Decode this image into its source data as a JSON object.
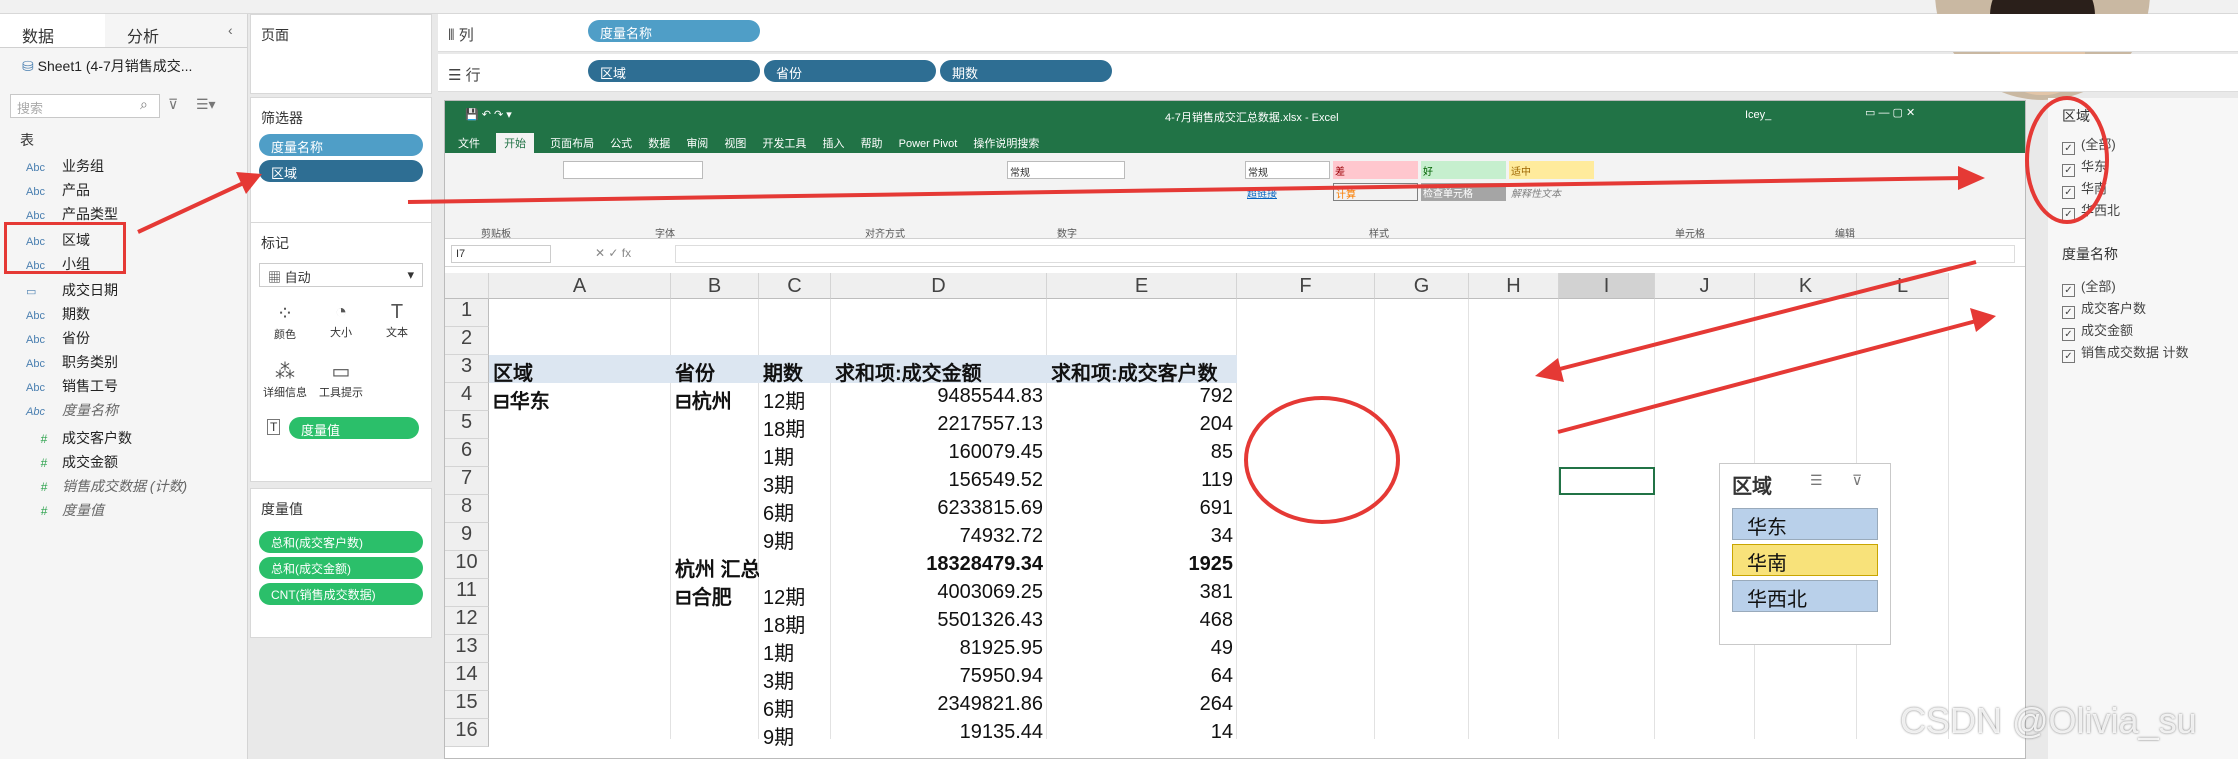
{
  "data_pane": {
    "tab_data": "数据",
    "tab_analysis": "分析",
    "datasource": "Sheet1 (4-7月销售成交...",
    "search_placeholder": "搜索",
    "table_header": "表",
    "dims": [
      "业务组",
      "产品",
      "产品类型",
      "区域",
      "小组",
      "成交日期",
      "期数",
      "省份",
      "职务类别",
      "销售工号"
    ],
    "measure_names": "度量名称",
    "measures": [
      "成交客户数",
      "成交金额",
      "销售成交数据 (计数)",
      "度量值"
    ]
  },
  "pages": {
    "label": "页面"
  },
  "filters": {
    "label": "筛选器",
    "pills": [
      "度量名称",
      "区域"
    ]
  },
  "marks": {
    "label": "标记",
    "type": "自动",
    "cells": [
      "颜色",
      "大小",
      "文本",
      "详细信息",
      "工具提示"
    ],
    "pill": "度量值"
  },
  "measure_values": {
    "label": "度量值",
    "pills": [
      "总和(成交客户数)",
      "总和(成交金额)",
      "CNT(销售成交数据)"
    ]
  },
  "columns": {
    "label": "列",
    "pills": [
      "度量名称"
    ]
  },
  "rows": {
    "label": "行",
    "pills": [
      "区域",
      "省份",
      "期数"
    ]
  },
  "excel": {
    "title": "4-7月销售成交汇总数据.xlsx - Excel",
    "user": "Icey_",
    "menu": [
      "文件",
      "开始",
      "页面布局",
      "公式",
      "数据",
      "审阅",
      "视图",
      "开发工具",
      "插入",
      "帮助",
      "Power Pivot",
      "操作说明搜索"
    ],
    "namebox": "I7",
    "ribbon_groups": [
      "剪贴板",
      "字体",
      "对齐方式",
      "数字",
      "样式",
      "单元格",
      "编辑"
    ],
    "style_labels": [
      "常规",
      "差",
      "好",
      "适中",
      "超链接",
      "计算",
      "检查单元格",
      "解释性文本"
    ],
    "columns": [
      "A",
      "B",
      "C",
      "D",
      "E",
      "F",
      "G",
      "H",
      "I",
      "J",
      "K",
      "L"
    ],
    "rows": [
      "1",
      "2",
      "3",
      "4",
      "5",
      "6",
      "7",
      "8",
      "9",
      "10",
      "11",
      "12",
      "13",
      "14",
      "15",
      "16"
    ],
    "headers": [
      "区域",
      "省份",
      "期数",
      "求和项:成交金额",
      "求和项:成交客户数"
    ],
    "region": "⊟华东",
    "province1": "⊟杭州",
    "province2": "⊟合肥",
    "subtotal_label": "杭州 汇总",
    "data": [
      [
        "12期",
        "9485544.83",
        "792"
      ],
      [
        "18期",
        "2217557.13",
        "204"
      ],
      [
        "1期",
        "160079.45",
        "85"
      ],
      [
        "3期",
        "156549.52",
        "119"
      ],
      [
        "6期",
        "6233815.69",
        "691"
      ],
      [
        "9期",
        "74932.72",
        "34"
      ],
      [
        "",
        "18328479.34",
        "1925"
      ],
      [
        "12期",
        "4003069.25",
        "381"
      ],
      [
        "18期",
        "5501326.43",
        "468"
      ],
      [
        "1期",
        "81925.95",
        "49"
      ],
      [
        "3期",
        "75950.94",
        "64"
      ],
      [
        "6期",
        "2349821.86",
        "264"
      ],
      [
        "9期",
        "19135.44",
        "14"
      ]
    ]
  },
  "slicer": {
    "title": "区域",
    "items": [
      "华东",
      "华南",
      "华西北"
    ]
  },
  "legend_region": {
    "title": "区域",
    "items": [
      "(全部)",
      "华东",
      "华南",
      "华西北"
    ]
  },
  "legend_measures": {
    "title": "度量名称",
    "items": [
      "(全部)",
      "成交客户数",
      "成交金额",
      "销售成交数据 计数"
    ]
  },
  "watermark": "CSDN @Olivia_su"
}
